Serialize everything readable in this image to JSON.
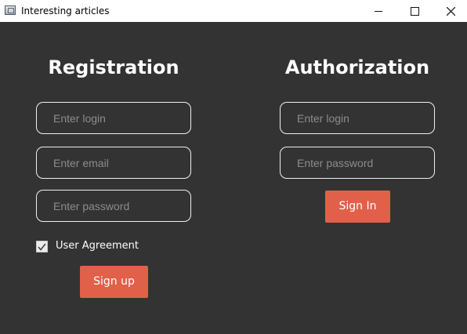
{
  "window": {
    "title": "Interesting articles"
  },
  "registration": {
    "heading": "Registration",
    "login_placeholder": "Enter login",
    "email_placeholder": "Enter email",
    "password_placeholder": "Enter password",
    "agreement_label": "User Agreement",
    "agreement_checked": true,
    "signup_label": "Sign up"
  },
  "authorization": {
    "heading": "Authorization",
    "login_placeholder": "Enter login",
    "password_placeholder": "Enter password",
    "signin_label": "Sign In"
  },
  "colors": {
    "background": "#333333",
    "accent": "#e1604a",
    "text": "#ffffff",
    "placeholder": "#8c8c8c"
  }
}
